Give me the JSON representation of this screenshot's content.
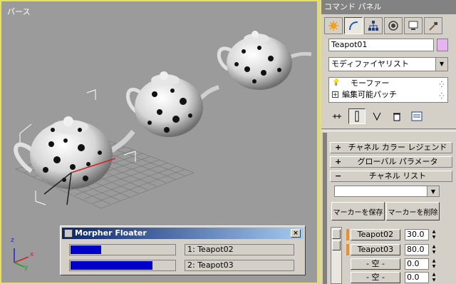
{
  "viewport": {
    "label": "パース",
    "axis_labels": {
      "x": "x",
      "y": "y",
      "z": "z"
    }
  },
  "command_panel": {
    "title": "コマンド パネル",
    "tabs": [
      {
        "name": "create",
        "icon": "create-icon"
      },
      {
        "name": "modify",
        "icon": "modify-icon"
      },
      {
        "name": "hierarchy",
        "icon": "hierarchy-icon"
      },
      {
        "name": "motion",
        "icon": "motion-icon"
      },
      {
        "name": "display",
        "icon": "display-icon"
      },
      {
        "name": "utilities",
        "icon": "utilities-icon"
      }
    ],
    "object_name": "Teapot01",
    "object_color": "#e6b4f0",
    "modifier_list": "モディファイヤリスト",
    "stack": [
      {
        "label": "モーファー",
        "icon": "bulb-icon"
      },
      {
        "label": "編集可能パッチ",
        "icon": "plus-box-icon"
      }
    ],
    "rollouts": [
      {
        "sign": "+",
        "label": "チャネル カラー レジェンド"
      },
      {
        "sign": "+",
        "label": "グローバル パラメータ"
      },
      {
        "sign": "−",
        "label": "チャネル リスト"
      }
    ],
    "save_marker": "マーカーを保存",
    "delete_marker": "マーカーを削除",
    "channels": [
      {
        "name": "Teapot02",
        "value": "30.0"
      },
      {
        "name": "Teapot03",
        "value": "80.0"
      },
      {
        "name": "- 空 -",
        "value": "0.0"
      },
      {
        "name": "- 空 -",
        "value": "0.0"
      }
    ]
  },
  "morpher_floater": {
    "title": "Morpher Floater",
    "close": "×",
    "targets": [
      {
        "label": "1: Teapot02",
        "percent": 30
      },
      {
        "label": "2: Teapot03",
        "percent": 80
      }
    ]
  }
}
